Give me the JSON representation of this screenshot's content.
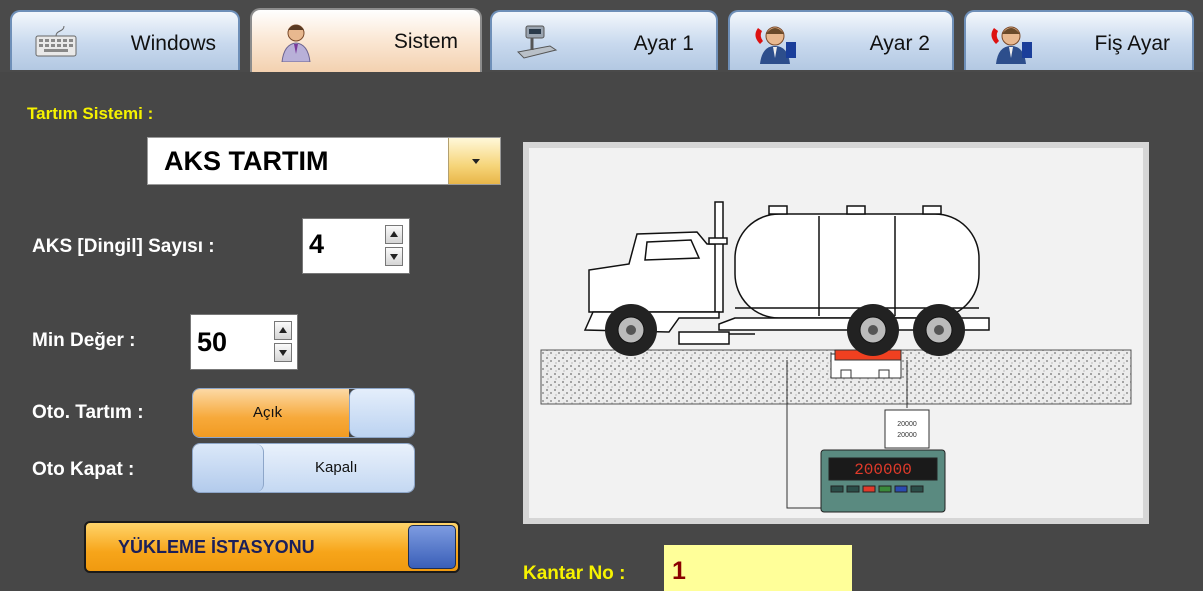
{
  "tabs": [
    {
      "label": "Windows",
      "icon": "keyboard-icon",
      "active": false
    },
    {
      "label": "Sistem",
      "icon": "user-icon",
      "active": true
    },
    {
      "label": "Ayar 1",
      "icon": "scale-icon",
      "active": false
    },
    {
      "label": "Ayar 2",
      "icon": "operator-phone-icon",
      "active": false
    },
    {
      "label": "Fiş Ayar",
      "icon": "operator-phone-icon",
      "active": false
    }
  ],
  "weighing_system": {
    "label": "Tartım Sistemi :",
    "value": "AKS TARTIM"
  },
  "axle_count": {
    "label": "AKS [Dingil] Sayısı :",
    "value": "4"
  },
  "min_value": {
    "label": "Min Değer :",
    "value": "50"
  },
  "auto_weigh": {
    "label": "Oto. Tartım :",
    "state": "Açık"
  },
  "auto_close": {
    "label": "Oto Kapat :",
    "state": "Kapalı"
  },
  "loading_station": {
    "label": "YÜKLEME İSTASYONU"
  },
  "indicator": {
    "display": "200000",
    "label_top": "20000",
    "label_bottom": "20000"
  },
  "scale_no": {
    "label": "Kantar No :",
    "value": "1"
  },
  "colors": {
    "accent_yellow": "#f6f200",
    "toggle_on": "#f7a93a",
    "toggle_off": "#c9dcf3"
  }
}
